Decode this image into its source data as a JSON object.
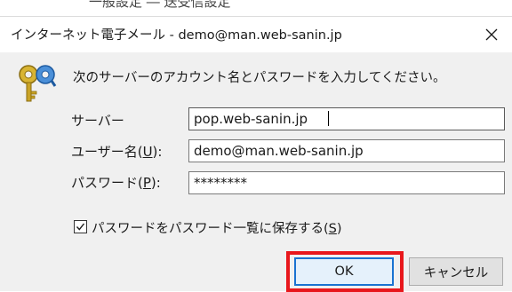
{
  "background_fragment": "一般設定 ― 送受信設定",
  "dialog": {
    "title": "インターネット電子メール - demo@man.web-sanin.jp",
    "close_symbol": "✕",
    "prompt": "次のサーバーのアカウント名とパスワードを入力してください。",
    "server_label": "サーバー",
    "server_value": "pop.web-sanin.jp",
    "username_label_prefix": "ユーザー名(",
    "username_accel": "U",
    "username_label_suffix": "):",
    "username_value": "demo@man.web-sanin.jp",
    "password_label_prefix": "パスワード(",
    "password_accel": "P",
    "password_label_suffix": "):",
    "password_value": "********",
    "save_password_prefix": "パスワードをパスワード一覧に保存する(",
    "save_password_accel": "S",
    "save_password_suffix": ")",
    "save_password_checked": true,
    "ok_label": "OK",
    "cancel_label": "キャンセル"
  },
  "colors": {
    "highlight": "#e8171c",
    "ok_focus": "#1a73d1",
    "dialog_bg": "#f0f0f0"
  },
  "icons": [
    "close-icon",
    "key-icon",
    "checkmark-icon"
  ]
}
